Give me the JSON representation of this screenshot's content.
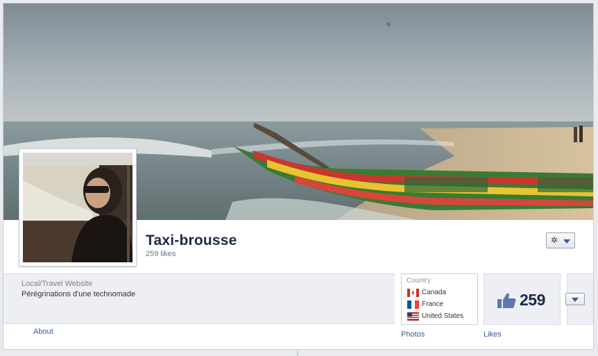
{
  "page": {
    "title": "Taxi-brousse",
    "likes_text": "259 likes",
    "category": "Local/Travel Website",
    "description": "Pérégrinations d'une technomade"
  },
  "nav": {
    "about_label": "About",
    "photos_label": "Photos",
    "likes_label": "Likes"
  },
  "country_box": {
    "header": "Country",
    "countries": [
      {
        "name": "Canada",
        "flag": "canada-flag-icon"
      },
      {
        "name": "France",
        "flag": "france-flag-icon"
      },
      {
        "name": "United States",
        "flag": "us-flag-icon"
      }
    ]
  },
  "likes_box": {
    "count": "259",
    "icon": "thumbs-up-icon"
  },
  "actions": {
    "gear_icon": "gear-icon",
    "dropdown_icon": "chevron-down-icon"
  },
  "colors": {
    "link": "#3b5998",
    "title": "#1c2a47",
    "band": "#edeff4"
  }
}
